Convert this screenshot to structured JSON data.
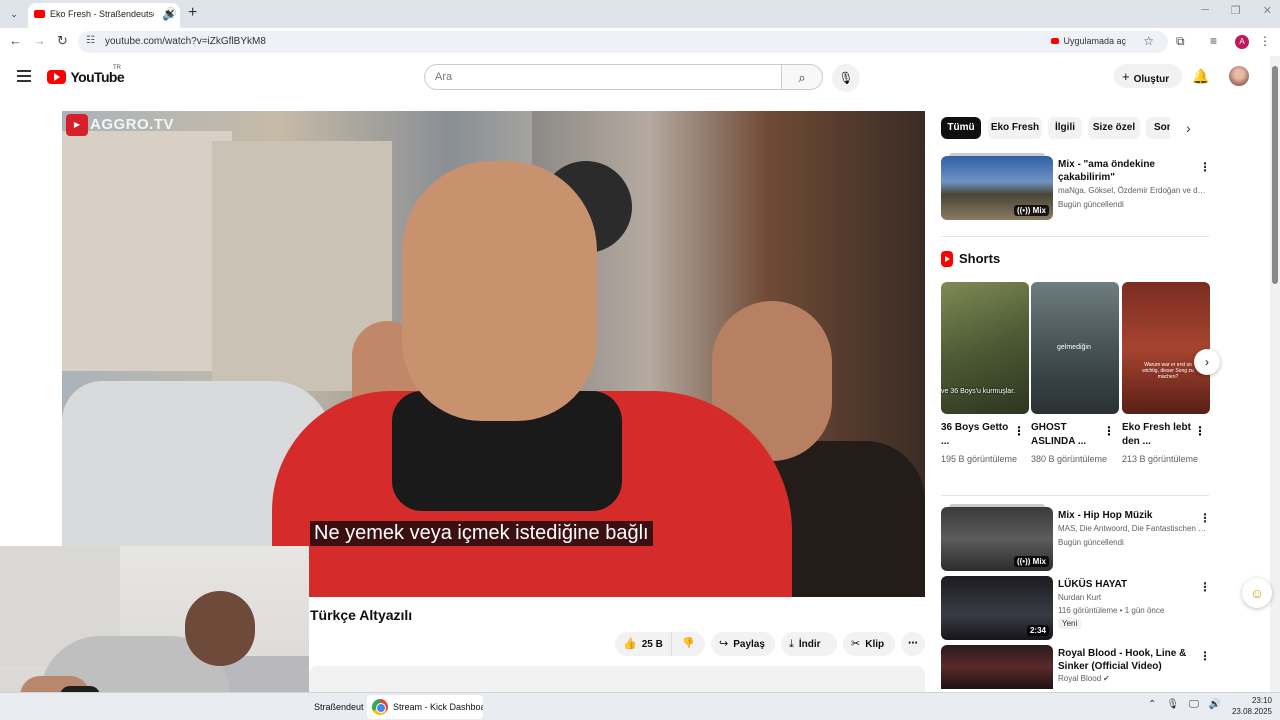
{
  "browser": {
    "tab_title": "Eko Fresh - Straßendeutsch",
    "url": "youtube.com/watch?v=iZkGflBYkM8",
    "open_in_app": "Uygulamada aç",
    "profile_initial": "A"
  },
  "youtube": {
    "logo_text": "YouTube",
    "country_code": "TR",
    "search_placeholder": "Ara",
    "create_label": "Oluştur"
  },
  "player": {
    "watermark": "AGGRO.TV",
    "subtitle": "Ne yemek veya içmek istediğine bağlı"
  },
  "video": {
    "title": "Türkçe Altyazılı",
    "likes": "25 B",
    "share_label": "Paylaş",
    "download_label": "İndir",
    "clip_label": "Klip"
  },
  "chips": [
    "Tümü",
    "Eko Fresh",
    "İlgili",
    "Size özel",
    "Son"
  ],
  "mix1": {
    "title": "Mix - \"ama öndekine çakabilirim\"",
    "channels": "maNga, Göksel, Özdemir Erdoğan ve dah...",
    "updated": "Bugün güncellendi",
    "badge": "Mix"
  },
  "shorts": {
    "header": "Shorts",
    "items": [
      {
        "title": "36 Boys Getto ...",
        "views": "195 B görüntüleme",
        "overlay": "ve 36 Boys'u kurmuşlar."
      },
      {
        "title": "GHOST ASLINDA ...",
        "views": "380 B görüntüleme",
        "overlay": "gelmediğin"
      },
      {
        "title": "Eko Fresh lebt den ...",
        "views": "213 B görüntüleme",
        "overlay": "Warum war er erst so wichtig, dieser Song zu machen?"
      }
    ]
  },
  "videos": [
    {
      "title": "Mix - Hip Hop Müzik",
      "line1": "MAS, Die Antwoord, Die Fantastischen Vi...",
      "line2": "Bugün güncellendi",
      "badge": "Mix"
    },
    {
      "title": "LÜKÜS HAYAT",
      "line1": "Nurdan Kurt",
      "line2": "116 görüntüleme • 1 gün önce",
      "badge": "2:34",
      "tag": "Yeni"
    },
    {
      "title": "Royal Blood - Hook, Line & Sinker (Official Video)",
      "line1": "Royal Blood",
      "line2": ""
    }
  ],
  "taskbar": {
    "task1": "Straßendeut",
    "task2": "Stream - Kick Dashboar",
    "time": "23:10",
    "date": "23.08.2025"
  },
  "colors": {
    "youtube_red": "#ff0000",
    "chip_active": "#0f0f0f"
  }
}
